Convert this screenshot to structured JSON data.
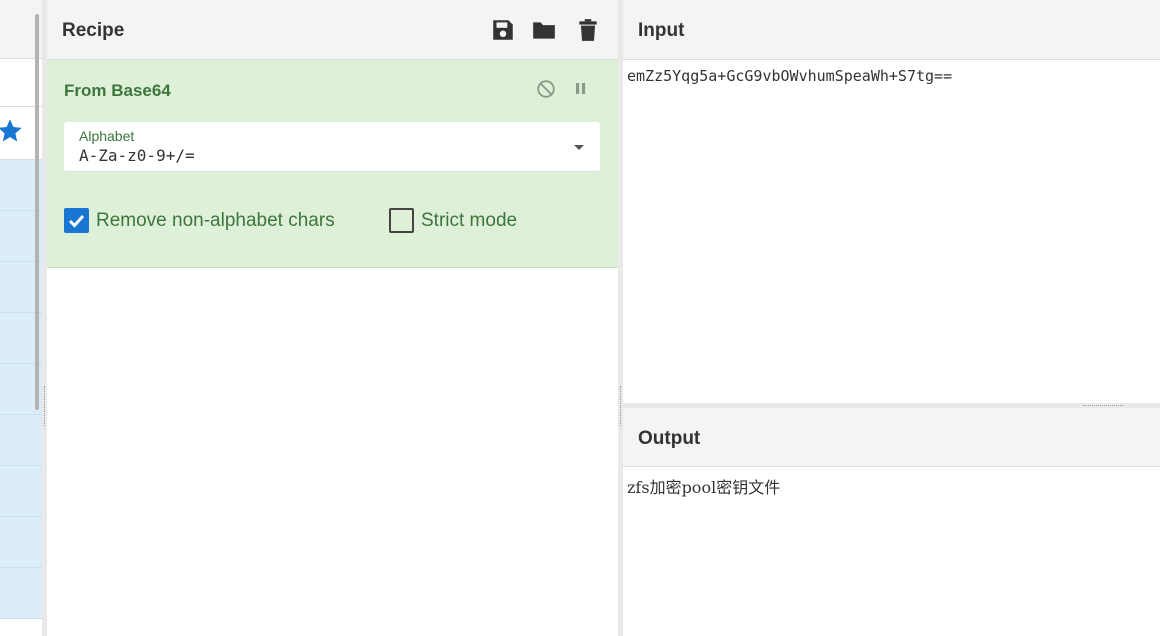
{
  "recipe": {
    "title": "Recipe",
    "toolbar": {
      "save_icon": "save-icon",
      "load_icon": "folder-icon",
      "clear_icon": "trash-icon"
    },
    "operation": {
      "title": "From Base64",
      "disable_icon": "disable-icon",
      "pause_icon": "pause-icon",
      "arg_label": "Alphabet",
      "arg_value": "A-Za-z0-9+/=",
      "checkboxes": [
        {
          "label": "Remove non-alphabet chars",
          "checked": true
        },
        {
          "label": "Strict mode",
          "checked": false
        }
      ]
    }
  },
  "input": {
    "title": "Input",
    "text": "emZz5Yqg5a+GcG9vbOWvhumSpeaWh+S7tg=="
  },
  "output": {
    "title": "Output",
    "text": "zfs加密pool密钥文件"
  },
  "colors": {
    "accent": "#1976d2",
    "operation_bg": "#dff0d8",
    "operation_text": "#3c763d",
    "favourite_star": "#1976d2"
  }
}
